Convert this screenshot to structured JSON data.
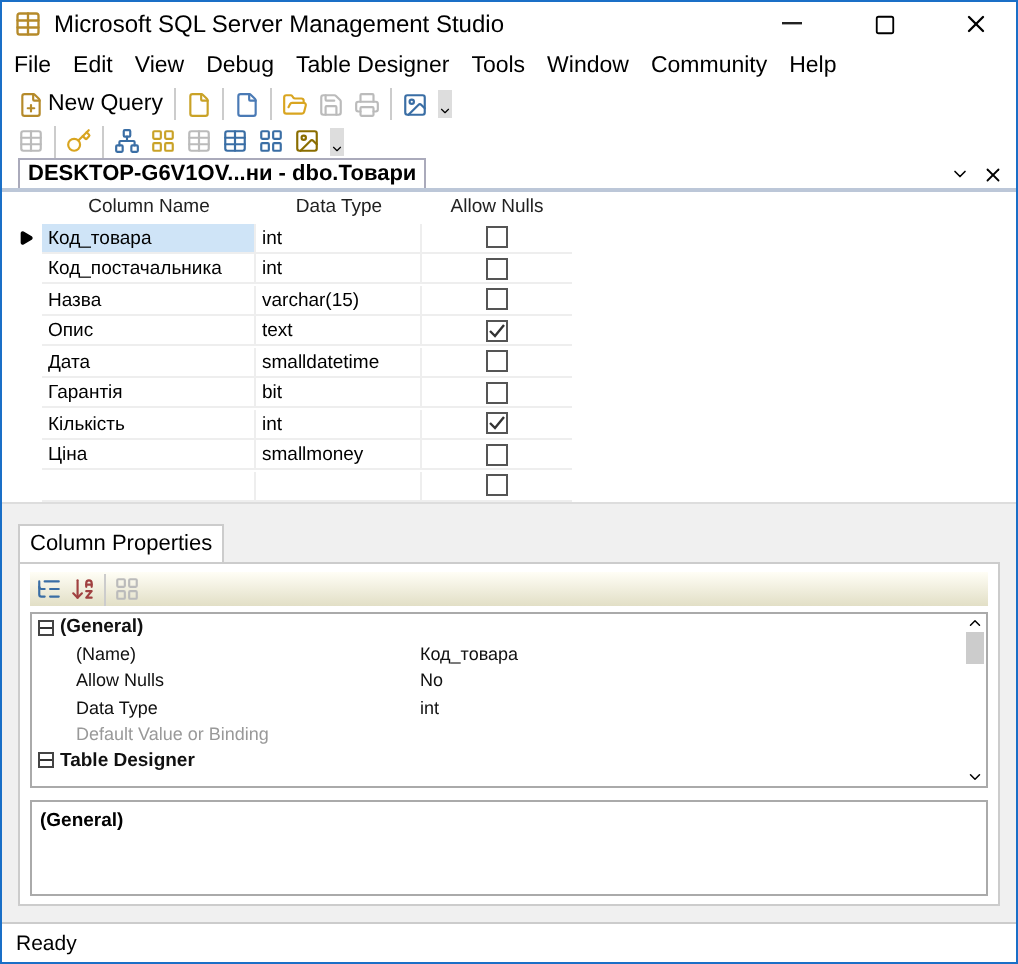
{
  "window": {
    "title": "Microsoft SQL Server Management Studio"
  },
  "menu": [
    "File",
    "Edit",
    "View",
    "Debug",
    "Table Designer",
    "Tools",
    "Window",
    "Community",
    "Help"
  ],
  "toolbar": {
    "new_query": "New Query"
  },
  "document_tab": {
    "label": "DESKTOP-G6V1OV...ни - dbo.Товари",
    "selected": true
  },
  "grid": {
    "columns": [
      "Column Name",
      "Data Type",
      "Allow Nulls"
    ],
    "rows": [
      {
        "name": "Код_товара",
        "type": "int",
        "allow_nulls": false,
        "selected": true
      },
      {
        "name": "Код_постачальника",
        "type": "int",
        "allow_nulls": false,
        "selected": false
      },
      {
        "name": "Назва",
        "type": "varchar(15)",
        "allow_nulls": false,
        "selected": false
      },
      {
        "name": "Опис",
        "type": "text",
        "allow_nulls": true,
        "selected": false
      },
      {
        "name": "Дата",
        "type": "smalldatetime",
        "allow_nulls": false,
        "selected": false
      },
      {
        "name": "Гарантія",
        "type": "bit",
        "allow_nulls": false,
        "selected": false
      },
      {
        "name": "Кількість",
        "type": "int",
        "allow_nulls": true,
        "selected": false
      },
      {
        "name": "Ціна",
        "type": "smallmoney",
        "allow_nulls": false,
        "selected": false
      },
      {
        "allow_nulls": false,
        "selected": false
      }
    ]
  },
  "properties_tab": {
    "label": "Column Properties",
    "selected": true
  },
  "properties": [
    {
      "kind": "category",
      "label": "(General)",
      "expanded": true
    },
    {
      "kind": "property",
      "label": "(Name)",
      "value": "Код_товара",
      "disabled": false
    },
    {
      "kind": "property",
      "label": "Allow Nulls",
      "value": "No",
      "disabled": false
    },
    {
      "kind": "property",
      "label": "Data Type",
      "value": "int",
      "disabled": false
    },
    {
      "kind": "property",
      "label": "Default Value or Binding",
      "disabled": true
    },
    {
      "kind": "category",
      "label": "Table Designer",
      "expanded": true
    }
  ],
  "description": {
    "title": "(General)"
  },
  "status_bar": {
    "text": "Ready"
  }
}
